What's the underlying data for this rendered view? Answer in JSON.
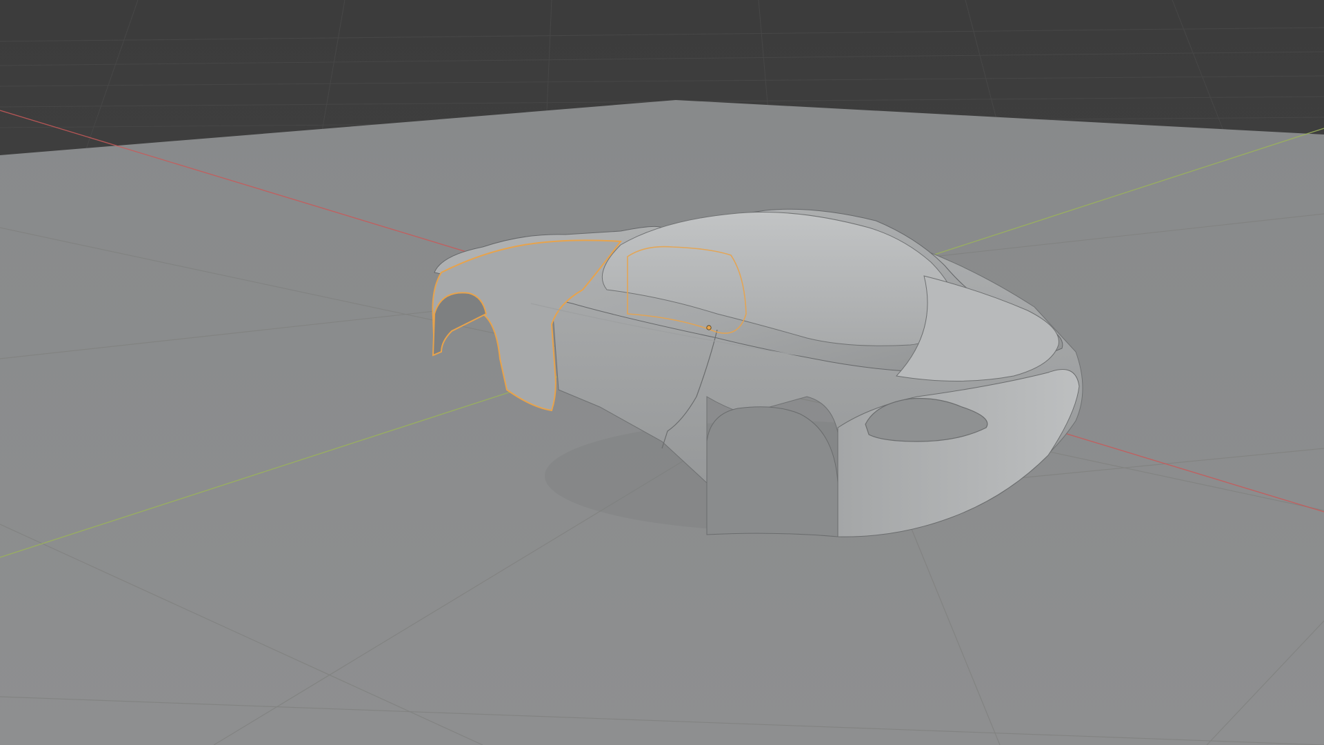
{
  "viewport": {
    "kind": "3d-viewport",
    "background_color": "#3f3f3f",
    "ground_color": "#8d8e8f",
    "grid_color": "#7f8081",
    "x_axis_color": "#c85a5a",
    "y_axis_color": "#9bb35a",
    "selection_color": "#e8a34b",
    "object_color": "#a9abac"
  },
  "scene": {
    "selected_object": "car-body-mesh",
    "selection_outline": "orange",
    "origin_marker": "object-origin-point"
  }
}
